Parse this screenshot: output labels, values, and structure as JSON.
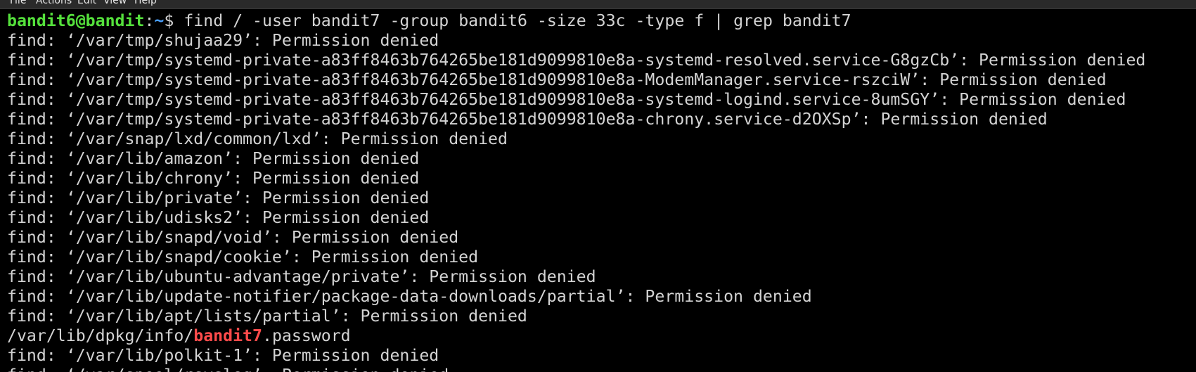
{
  "menu": {
    "items": [
      "File",
      "Actions",
      "Edit",
      "View",
      "Help"
    ]
  },
  "prompt": {
    "user_host": "bandit6@bandit",
    "colon": ":",
    "path": "~",
    "symbol": "$ ",
    "command": "find / -user bandit7 -group bandit6 -size 33c -type f | grep bandit7"
  },
  "output": {
    "lines": [
      "find: ‘/var/tmp/shujaa29’: Permission denied",
      "find: ‘/var/tmp/systemd-private-a83ff8463b764265be181d9099810e8a-systemd-resolved.service-G8gzCb’: Permission denied",
      "find: ‘/var/tmp/systemd-private-a83ff8463b764265be181d9099810e8a-ModemManager.service-rszciW’: Permission denied",
      "find: ‘/var/tmp/systemd-private-a83ff8463b764265be181d9099810e8a-systemd-logind.service-8umSGY’: Permission denied",
      "find: ‘/var/tmp/systemd-private-a83ff8463b764265be181d9099810e8a-chrony.service-d2OXSp’: Permission denied",
      "find: ‘/var/snap/lxd/common/lxd’: Permission denied",
      "find: ‘/var/lib/amazon’: Permission denied",
      "find: ‘/var/lib/chrony’: Permission denied",
      "find: ‘/var/lib/private’: Permission denied",
      "find: ‘/var/lib/udisks2’: Permission denied",
      "find: ‘/var/lib/snapd/void’: Permission denied",
      "find: ‘/var/lib/snapd/cookie’: Permission denied",
      "find: ‘/var/lib/ubuntu-advantage/private’: Permission denied",
      "find: ‘/var/lib/update-notifier/package-data-downloads/partial’: Permission denied",
      "find: ‘/var/lib/apt/lists/partial’: Permission denied"
    ],
    "match": {
      "prefix": "/var/lib/dpkg/info/",
      "highlight": "bandit7",
      "suffix": ".password"
    },
    "after_lines": [
      "find: ‘/var/lib/polkit-1’: Permission denied",
      "find: ‘/var/spool/rsyslog’: Permission denied"
    ]
  },
  "colors": {
    "background": "#000000",
    "text": "#d3d3d3",
    "prompt_user": "#55e13c",
    "prompt_path": "#4aa0ff",
    "match_highlight": "#ff4b4b"
  }
}
